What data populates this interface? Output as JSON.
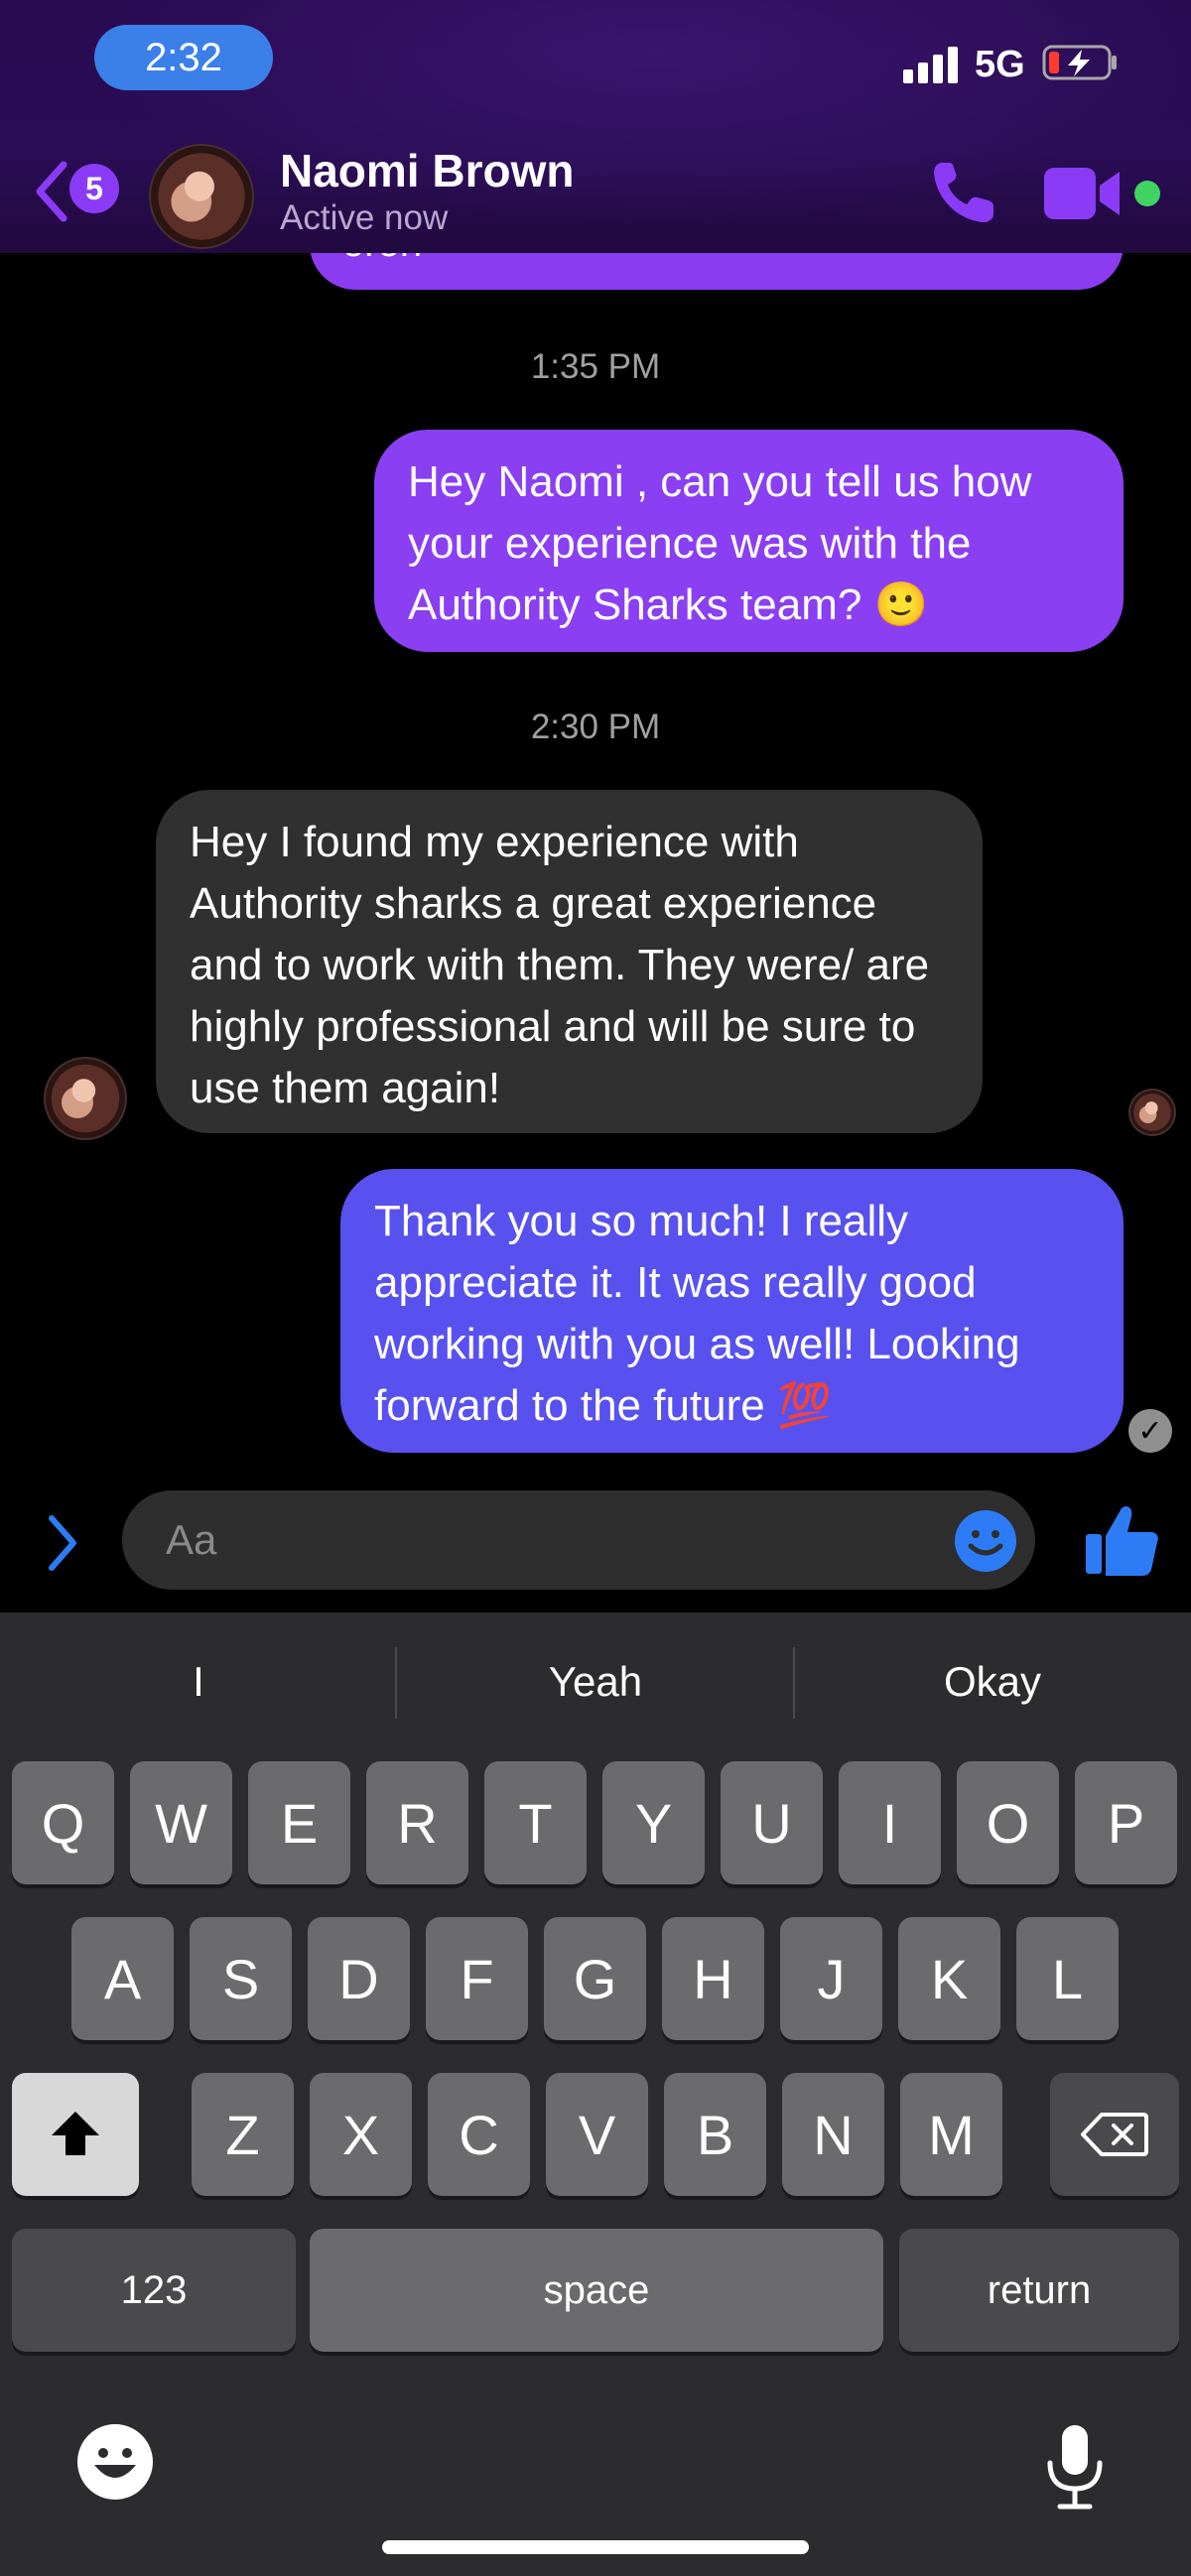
{
  "status_bar": {
    "time": "2:32",
    "network": "5G",
    "battery": "low-charging"
  },
  "header": {
    "back_badge_count": "5",
    "contact_name": "Naomi Brown",
    "contact_status": "Active now",
    "icons": [
      "chevron-left-icon",
      "phone-icon",
      "video-icon",
      "online-dot"
    ]
  },
  "chat": {
    "previous_bubble_fragment": "oron",
    "messages": [
      {
        "type": "timestamp",
        "text": "1:35 PM"
      },
      {
        "type": "outgoing",
        "text": "Hey Naomi , can you tell us how your experience was with the Authority Sharks team? 🙂",
        "color": "#8a3ff3"
      },
      {
        "type": "timestamp",
        "text": "2:30 PM"
      },
      {
        "type": "incoming",
        "text": "Hey I found my experience with Authority sharks a great experience and to work with them. They were/ are highly professional and will be sure to use them again!",
        "color": "#303030"
      },
      {
        "type": "outgoing",
        "text": "Thank you so much! I really appreciate it. It was really good working with you as well! Looking forward to the future 💯",
        "color": "#5851f0"
      }
    ]
  },
  "composer": {
    "placeholder": "Aa",
    "icons": [
      "chevron-right-icon",
      "emoji-icon",
      "thumbs-up-icon"
    ]
  },
  "keyboard": {
    "suggestions": [
      "I",
      "Yeah",
      "Okay"
    ],
    "row1": [
      "Q",
      "W",
      "E",
      "R",
      "T",
      "Y",
      "U",
      "I",
      "O",
      "P"
    ],
    "row2": [
      "A",
      "S",
      "D",
      "F",
      "G",
      "H",
      "J",
      "K",
      "L"
    ],
    "row3": [
      "Z",
      "X",
      "C",
      "V",
      "B",
      "N",
      "M"
    ],
    "numbers_label": "123",
    "space_label": "space",
    "return_label": "return",
    "icons": [
      "shift-icon",
      "backspace-icon",
      "emoji-keyboard-icon",
      "microphone-icon"
    ]
  },
  "colors": {
    "accent": "#8b3bf5",
    "outgoing_bubble": "#8a3ff3",
    "outgoing_bubble_2": "#5851f0",
    "incoming_bubble": "#303030",
    "messenger_blue": "#2d7cf6",
    "online_green": "#3fd461"
  }
}
